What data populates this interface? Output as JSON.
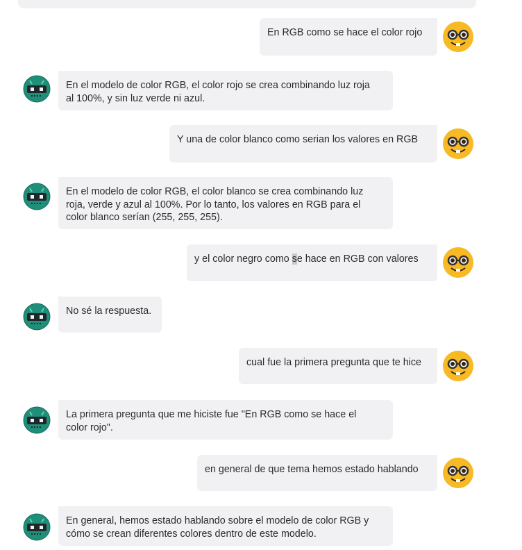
{
  "messages": [
    {
      "role": "user",
      "text": "En RGB como se hace el color rojo"
    },
    {
      "role": "bot",
      "text": "En el modelo de color RGB, el color rojo se crea combinando luz roja\nal 100%, y sin luz verde ni azul."
    },
    {
      "role": "user",
      "text": "Y una de color blanco como serian los valores en RGB"
    },
    {
      "role": "bot",
      "text": "En el modelo de color RGB, el color blanco se crea combinando luz\nroja, verde y azul al 100%. Por lo tanto, los valores en RGB para el\ncolor blanco serían (255, 255, 255)."
    },
    {
      "role": "user",
      "text_before": "y el color negro como ",
      "text_highlight": "s",
      "text_after": "e hace en RGB con valores"
    },
    {
      "role": "bot",
      "text": "No sé la respuesta."
    },
    {
      "role": "user",
      "text": "cual fue la primera pregunta que te hice"
    },
    {
      "role": "bot",
      "text": "La primera pregunta que me hiciste fue \"En RGB como se hace el\ncolor rojo\"."
    },
    {
      "role": "user",
      "text": "en general de que tema hemos estado hablando"
    },
    {
      "role": "bot",
      "text": "En general, hemos estado hablando sobre el modelo de color RGB y\ncómo se crean diferentes colores dentro de este modelo."
    }
  ],
  "avatars": {
    "user": {
      "icon": "nerd-glasses-emoji-icon",
      "color": "#f7b924"
    },
    "bot": {
      "icon": "robot-icon",
      "color": "#1f8f7a"
    }
  }
}
